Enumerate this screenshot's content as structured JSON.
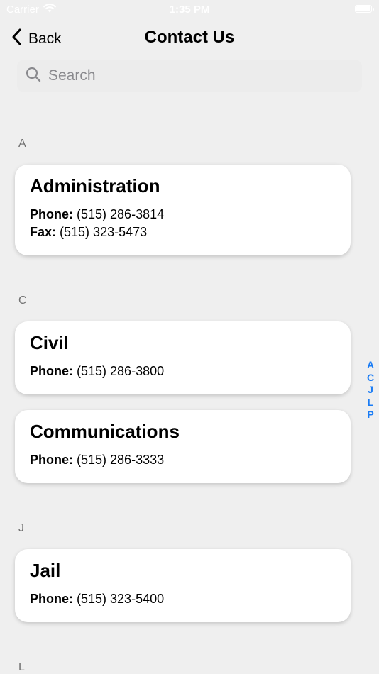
{
  "status_bar": {
    "carrier": "Carrier",
    "time": "1:35 PM"
  },
  "nav": {
    "back_label": "Back",
    "title": "Contact Us"
  },
  "search": {
    "placeholder": "Search",
    "value": ""
  },
  "sections": [
    {
      "letter": "A",
      "contacts": [
        {
          "name": "Administration",
          "lines": [
            {
              "label": "Phone:",
              "value": "(515) 286-3814"
            },
            {
              "label": "Fax:",
              "value": "(515) 323-5473"
            }
          ]
        }
      ]
    },
    {
      "letter": "C",
      "contacts": [
        {
          "name": "Civil",
          "lines": [
            {
              "label": "Phone:",
              "value": "(515) 286-3800"
            }
          ]
        },
        {
          "name": "Communications",
          "lines": [
            {
              "label": "Phone:",
              "value": "(515) 286-3333"
            }
          ]
        }
      ]
    },
    {
      "letter": "J",
      "contacts": [
        {
          "name": "Jail",
          "lines": [
            {
              "label": "Phone:",
              "value": "(515) 323-5400"
            }
          ]
        }
      ]
    },
    {
      "letter": "L",
      "contacts": []
    }
  ],
  "index": [
    "A",
    "C",
    "J",
    "L",
    "P"
  ],
  "colors": {
    "accent": "#1a7cf5",
    "background": "#efefef",
    "card": "#ffffff",
    "section_header": "#707070"
  }
}
